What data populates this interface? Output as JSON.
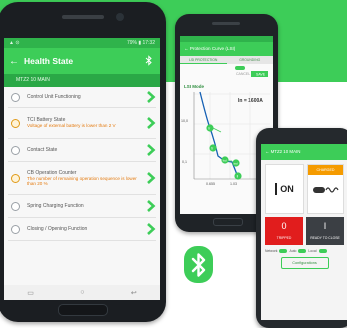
{
  "phone_main": {
    "status_left": "▲ ⊙",
    "status_right": "79% ▮ 17:32",
    "title": "Health State",
    "device": "MTZ2 10 MAIN",
    "items": [
      {
        "label": "Control Unit Functioning",
        "warning": "",
        "state": "ok"
      },
      {
        "label": "TCI Battery State",
        "warning": "Voltage of external battery is lower than 2 V",
        "state": "warn"
      },
      {
        "label": "Contact State",
        "warning": "",
        "state": "ok"
      },
      {
        "label": "CB Operation Counter",
        "warning": "The number of remaining operation sequence is lower than 20 %",
        "state": "warn"
      },
      {
        "label": "Spring Charging Function",
        "warning": "",
        "state": "ok"
      },
      {
        "label": "Closing / Opening Function",
        "warning": "",
        "state": "ok"
      }
    ]
  },
  "phone_curve": {
    "title": "Protection Curve (LSI)",
    "tabs": [
      "LSI PROTECTION",
      "GROUNDING"
    ],
    "mode_label": "LSI Mode",
    "in_label": "In = 1600A",
    "controls": [
      "CANCEL",
      "SAVE"
    ],
    "y_ticks": [
      "10,0",
      "0,1"
    ],
    "x_ticks": [
      "0.655",
      "1.03"
    ],
    "points": [
      "Ir",
      "tr",
      "Isd",
      "tsd",
      "Ii"
    ]
  },
  "phone_status": {
    "device": "MTZ2 10 MAIN",
    "state_label": "ON",
    "spring_label": "CHARGED",
    "tile_left_value": "0",
    "tile_left_label": "TRIPPED",
    "tile_right_value": "I",
    "tile_right_label": "READY TO CLOSE",
    "small_labels": [
      "Network",
      "Auto",
      "Local"
    ],
    "config_button": "Configurations"
  },
  "colors": {
    "brand_green": "#3dcd58",
    "warning_orange": "#e47b10"
  }
}
